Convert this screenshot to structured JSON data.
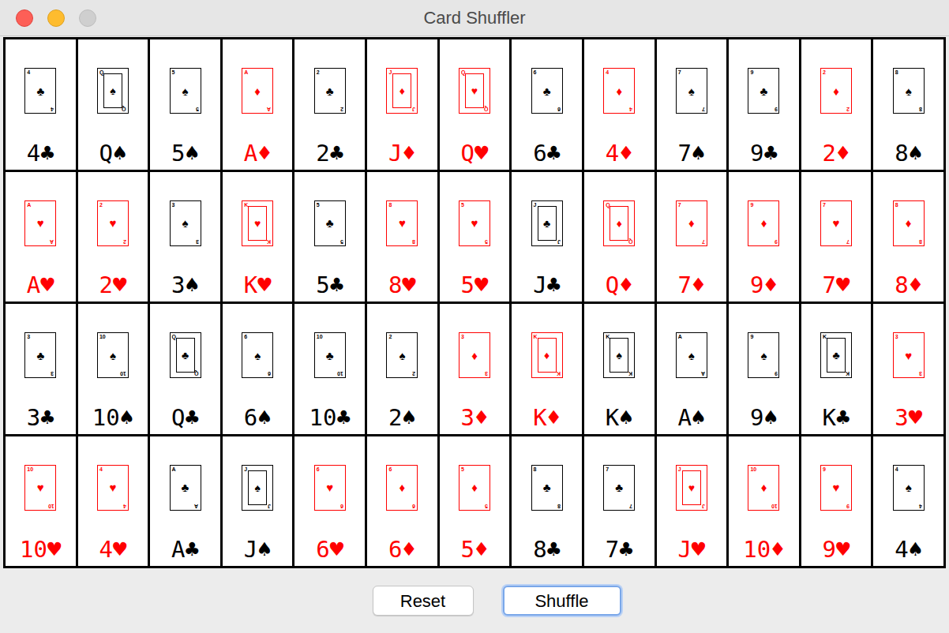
{
  "window": {
    "title": "Card Shuffler"
  },
  "cards": [
    {
      "label": "4♣",
      "rank": "4",
      "suit": "♣",
      "color": "#000000"
    },
    {
      "label": "Q♠",
      "rank": "Q",
      "suit": "♠",
      "color": "#000000"
    },
    {
      "label": "5♠",
      "rank": "5",
      "suit": "♠",
      "color": "#000000"
    },
    {
      "label": "A♦",
      "rank": "A",
      "suit": "♦",
      "color": "#ff0000"
    },
    {
      "label": "2♣",
      "rank": "2",
      "suit": "♣",
      "color": "#000000"
    },
    {
      "label": "J♦",
      "rank": "J",
      "suit": "♦",
      "color": "#ff0000"
    },
    {
      "label": "Q♥",
      "rank": "Q",
      "suit": "♥",
      "color": "#ff0000"
    },
    {
      "label": "6♣",
      "rank": "6",
      "suit": "♣",
      "color": "#000000"
    },
    {
      "label": "4♦",
      "rank": "4",
      "suit": "♦",
      "color": "#ff0000"
    },
    {
      "label": "7♠",
      "rank": "7",
      "suit": "♠",
      "color": "#000000"
    },
    {
      "label": "9♣",
      "rank": "9",
      "suit": "♣",
      "color": "#000000"
    },
    {
      "label": "2♦",
      "rank": "2",
      "suit": "♦",
      "color": "#ff0000"
    },
    {
      "label": "8♠",
      "rank": "8",
      "suit": "♠",
      "color": "#000000"
    },
    {
      "label": "A♥",
      "rank": "A",
      "suit": "♥",
      "color": "#ff0000"
    },
    {
      "label": "2♥",
      "rank": "2",
      "suit": "♥",
      "color": "#ff0000"
    },
    {
      "label": "3♠",
      "rank": "3",
      "suit": "♠",
      "color": "#000000"
    },
    {
      "label": "K♥",
      "rank": "K",
      "suit": "♥",
      "color": "#ff0000"
    },
    {
      "label": "5♣",
      "rank": "5",
      "suit": "♣",
      "color": "#000000"
    },
    {
      "label": "8♥",
      "rank": "8",
      "suit": "♥",
      "color": "#ff0000"
    },
    {
      "label": "5♥",
      "rank": "5",
      "suit": "♥",
      "color": "#ff0000"
    },
    {
      "label": "J♣",
      "rank": "J",
      "suit": "♣",
      "color": "#000000"
    },
    {
      "label": "Q♦",
      "rank": "Q",
      "suit": "♦",
      "color": "#ff0000"
    },
    {
      "label": "7♦",
      "rank": "7",
      "suit": "♦",
      "color": "#ff0000"
    },
    {
      "label": "9♦",
      "rank": "9",
      "suit": "♦",
      "color": "#ff0000"
    },
    {
      "label": "7♥",
      "rank": "7",
      "suit": "♥",
      "color": "#ff0000"
    },
    {
      "label": "8♦",
      "rank": "8",
      "suit": "♦",
      "color": "#ff0000"
    },
    {
      "label": "3♣",
      "rank": "3",
      "suit": "♣",
      "color": "#000000"
    },
    {
      "label": "10♠",
      "rank": "10",
      "suit": "♠",
      "color": "#000000"
    },
    {
      "label": "Q♣",
      "rank": "Q",
      "suit": "♣",
      "color": "#000000"
    },
    {
      "label": "6♠",
      "rank": "6",
      "suit": "♠",
      "color": "#000000"
    },
    {
      "label": "10♣",
      "rank": "10",
      "suit": "♣",
      "color": "#000000"
    },
    {
      "label": "2♠",
      "rank": "2",
      "suit": "♠",
      "color": "#000000"
    },
    {
      "label": "3♦",
      "rank": "3",
      "suit": "♦",
      "color": "#ff0000"
    },
    {
      "label": "K♦",
      "rank": "K",
      "suit": "♦",
      "color": "#ff0000"
    },
    {
      "label": "K♠",
      "rank": "K",
      "suit": "♠",
      "color": "#000000"
    },
    {
      "label": "A♠",
      "rank": "A",
      "suit": "♠",
      "color": "#000000"
    },
    {
      "label": "9♠",
      "rank": "9",
      "suit": "♠",
      "color": "#000000"
    },
    {
      "label": "K♣",
      "rank": "K",
      "suit": "♣",
      "color": "#000000"
    },
    {
      "label": "3♥",
      "rank": "3",
      "suit": "♥",
      "color": "#ff0000"
    },
    {
      "label": "10♥",
      "rank": "10",
      "suit": "♥",
      "color": "#ff0000"
    },
    {
      "label": "4♥",
      "rank": "4",
      "suit": "♥",
      "color": "#ff0000"
    },
    {
      "label": "A♣",
      "rank": "A",
      "suit": "♣",
      "color": "#000000"
    },
    {
      "label": "J♠",
      "rank": "J",
      "suit": "♠",
      "color": "#000000"
    },
    {
      "label": "6♥",
      "rank": "6",
      "suit": "♥",
      "color": "#ff0000"
    },
    {
      "label": "6♦",
      "rank": "6",
      "suit": "♦",
      "color": "#ff0000"
    },
    {
      "label": "5♦",
      "rank": "5",
      "suit": "♦",
      "color": "#ff0000"
    },
    {
      "label": "8♣",
      "rank": "8",
      "suit": "♣",
      "color": "#000000"
    },
    {
      "label": "7♣",
      "rank": "7",
      "suit": "♣",
      "color": "#000000"
    },
    {
      "label": "J♥",
      "rank": "J",
      "suit": "♥",
      "color": "#ff0000"
    },
    {
      "label": "10♦",
      "rank": "10",
      "suit": "♦",
      "color": "#ff0000"
    },
    {
      "label": "9♥",
      "rank": "9",
      "suit": "♥",
      "color": "#ff0000"
    },
    {
      "label": "4♠",
      "rank": "4",
      "suit": "♠",
      "color": "#000000"
    }
  ],
  "buttons": [
    {
      "label": "Reset",
      "focused": false
    },
    {
      "label": "Shuffle",
      "focused": true
    }
  ]
}
